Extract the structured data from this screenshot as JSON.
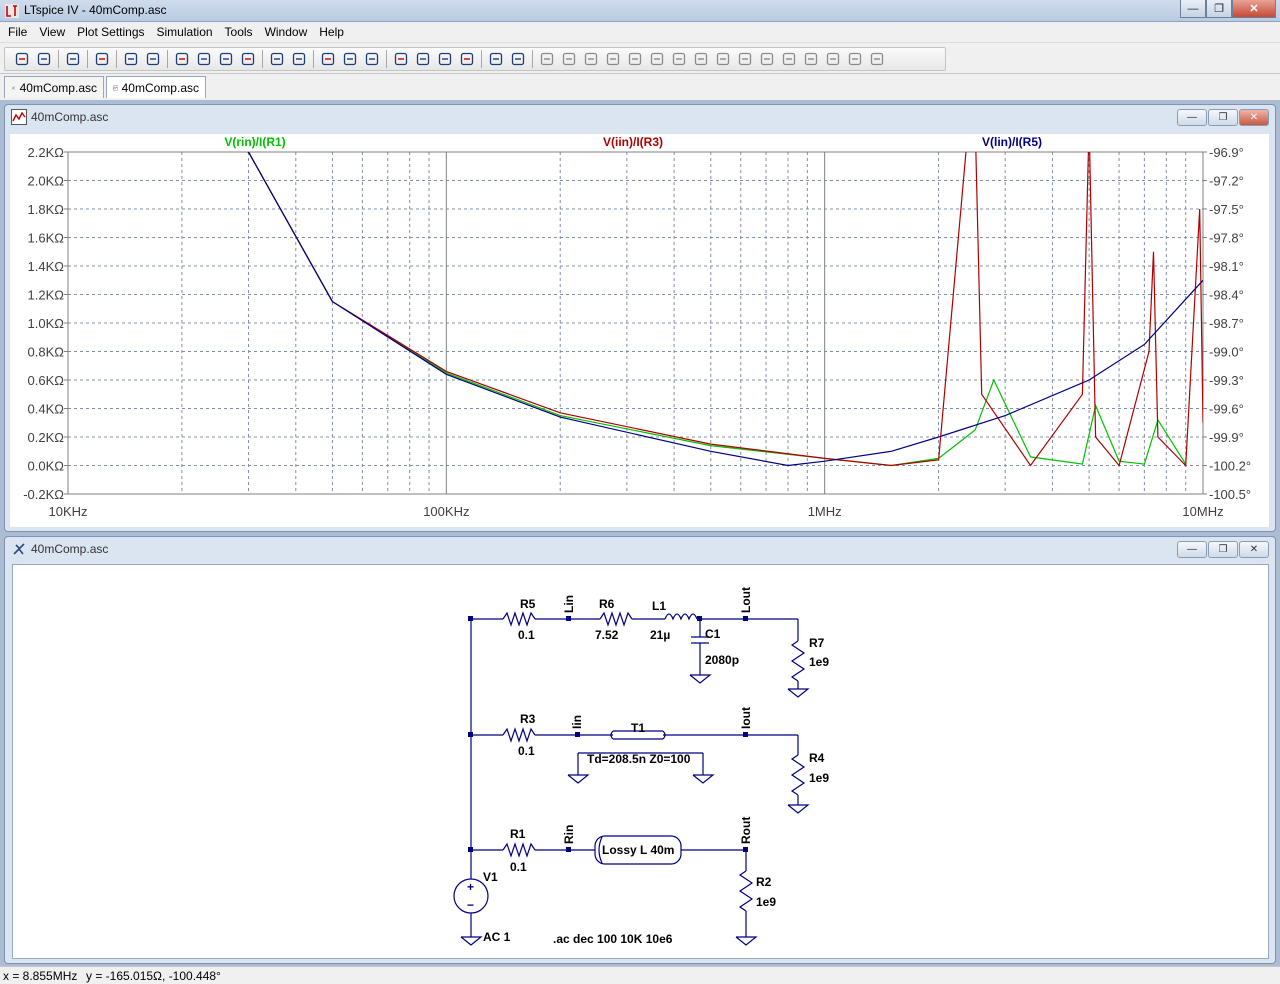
{
  "window": {
    "title": "LTspice IV - 40mComp.asc"
  },
  "menu": [
    "File",
    "View",
    "Plot Settings",
    "Simulation",
    "Tools",
    "Window",
    "Help"
  ],
  "toolbar_icons": [
    "new-schematic-icon",
    "open-icon",
    "save-icon",
    "control-panel-icon",
    "run-icon",
    "halt-icon",
    "zoom-in-icon",
    "zoom-pan-icon",
    "zoom-out-icon",
    "zoom-cancel-icon",
    "autorange-icon",
    "fit-icon",
    "tile-horizontal-icon",
    "cascade-icon",
    "close-all-icon",
    "cut-icon",
    "copy-icon",
    "paste-icon",
    "find-icon",
    "print-setup-icon",
    "print-icon",
    "wire-icon",
    "ground-icon",
    "label-icon",
    "resistor-icon",
    "capacitor-icon",
    "inductor-icon",
    "diode-icon",
    "component-icon",
    "move-icon",
    "drag-icon",
    "undo-icon",
    "redo-icon",
    "rotate-icon",
    "mirror-icon",
    "text-icon",
    "spice-directive-icon"
  ],
  "tabs": [
    {
      "label": "40mComp.asc",
      "kind": "schematic"
    },
    {
      "label": "40mComp.asc",
      "kind": "plot"
    }
  ],
  "plot_window": {
    "title": "40mComp.asc"
  },
  "schematic_window": {
    "title": "40mComp.asc"
  },
  "chart_data": {
    "type": "line",
    "x_scale": "log",
    "xlim": [
      10000,
      10000000
    ],
    "x_tick_labels": [
      "10KHz",
      "100KHz",
      "1MHz",
      "10MHz"
    ],
    "y_tick_labels_left": [
      "2.2KΩ",
      "2.0KΩ",
      "1.8KΩ",
      "1.6KΩ",
      "1.4KΩ",
      "1.2KΩ",
      "1.0KΩ",
      "0.8KΩ",
      "0.6KΩ",
      "0.4KΩ",
      "0.2KΩ",
      "0.0KΩ",
      "-0.2KΩ"
    ],
    "y_tick_labels_right": [
      "-96.9°",
      "-97.2°",
      "-97.5°",
      "-97.8°",
      "-98.1°",
      "-98.4°",
      "-98.7°",
      "-99.0°",
      "-99.3°",
      "-99.6°",
      "-99.9°",
      "-100.2°",
      "-100.5°"
    ],
    "ylim": [
      -0.2,
      2.2
    ],
    "y_unit": "KΩ",
    "grid": true,
    "series": [
      {
        "name": "V(rin)/I(R1)",
        "color": "#00c000",
        "x": [
          10000,
          30000,
          50000,
          100000,
          200000,
          500000,
          1000000,
          1500000,
          2000000,
          2500000,
          2800000,
          3500000,
          4800000,
          5200000,
          6000000,
          7000000,
          7600000,
          9000000
        ],
        "y": [
          2.6,
          2.2,
          1.15,
          0.65,
          0.35,
          0.14,
          0.05,
          0.0,
          0.05,
          0.25,
          0.6,
          0.06,
          0.01,
          0.42,
          0.03,
          0.01,
          0.32,
          0.01
        ]
      },
      {
        "name": "V(iin)/I(R3)",
        "color": "#b00000",
        "x": [
          10000,
          30000,
          50000,
          100000,
          200000,
          500000,
          1000000,
          1500000,
          2000000,
          2400000,
          2500000,
          2600000,
          3500000,
          4800000,
          5000000,
          5200000,
          6000000,
          7200000,
          7400000,
          7600000,
          9000000,
          9800000,
          10000000
        ],
        "y": [
          2.6,
          2.2,
          1.15,
          0.66,
          0.37,
          0.15,
          0.05,
          0.0,
          0.04,
          2.4,
          2.4,
          0.5,
          0.0,
          0.5,
          2.4,
          0.2,
          0.0,
          0.8,
          1.5,
          0.2,
          0.0,
          1.8,
          0.3
        ]
      },
      {
        "name": "V(lin)/I(R5)",
        "color": "#000080",
        "x": [
          10000,
          30000,
          50000,
          100000,
          200000,
          500000,
          800000,
          1000000,
          1500000,
          2000000,
          3000000,
          5000000,
          7000000,
          10000000
        ],
        "y": [
          2.6,
          2.2,
          1.15,
          0.64,
          0.34,
          0.1,
          0.0,
          0.03,
          0.1,
          0.2,
          0.35,
          0.6,
          0.85,
          1.3
        ]
      }
    ]
  },
  "schematic": {
    "components": [
      {
        "ref": "R5",
        "value": "0.1"
      },
      {
        "ref": "R6",
        "value": "7.52"
      },
      {
        "ref": "L1",
        "value": "21µ"
      },
      {
        "ref": "C1",
        "value": "2080p"
      },
      {
        "ref": "R7",
        "value": "1e9"
      },
      {
        "ref": "R3",
        "value": "0.1"
      },
      {
        "ref": "T1",
        "value": "Td=208.5n Z0=100"
      },
      {
        "ref": "R4",
        "value": "1e9"
      },
      {
        "ref": "R1",
        "value": "0.1"
      },
      {
        "ref": "R2",
        "value": "1e9"
      },
      {
        "ref": "V1",
        "value": "AC 1"
      }
    ],
    "lossy_line": "Lossy L 40m",
    "net_labels": [
      "Lin",
      "Lout",
      "Iin",
      "Iout",
      "Rin",
      "Rout"
    ],
    "directive": ".ac dec 100 10K 10e6"
  },
  "status": {
    "x": "x = 8.855MHz",
    "y": "y = -165.015Ω, -100.448°"
  }
}
